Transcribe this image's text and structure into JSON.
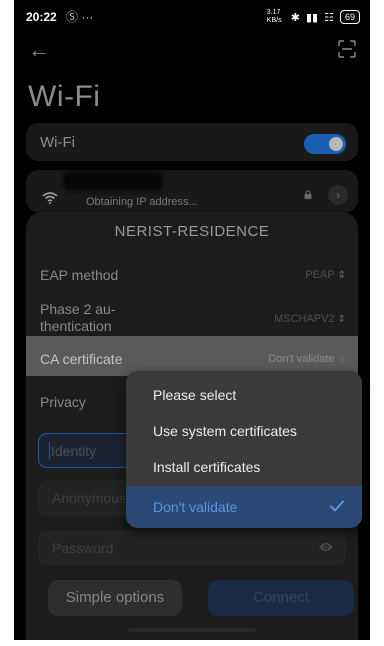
{
  "status": {
    "time": "20:22",
    "left_icons": "Ⓢ ···",
    "speed": "3.17 KB/s",
    "battery": "69"
  },
  "header": {
    "title": "Wi-Fi"
  },
  "wifi_toggle": {
    "label": "Wi-Fi",
    "on": true
  },
  "network": {
    "status": "Obtaining IP address..."
  },
  "dialog": {
    "title": "NERIST-RESIDENCE",
    "eap_label": "EAP method",
    "eap_value": "PEAP",
    "phase2_label_line1": "Phase 2 au-",
    "phase2_label_line2": "thentication",
    "phase2_value": "MSCHAPV2",
    "ca_label": "CA certificate",
    "ca_value": "Don't validate",
    "privacy_label": "Privacy",
    "identity_placeholder": "Identity",
    "anonymous_placeholder": "Anonymous identity",
    "password_placeholder": "Password",
    "simple_button": "Simple options",
    "connect_button": "Connect"
  },
  "dropdown": {
    "options": [
      "Please select",
      "Use system certificates",
      "Install certificates",
      "Don't validate"
    ],
    "selected": "Don't validate"
  },
  "colors": {
    "accent": "#1b5fb3",
    "selected_text": "#5d93df"
  }
}
